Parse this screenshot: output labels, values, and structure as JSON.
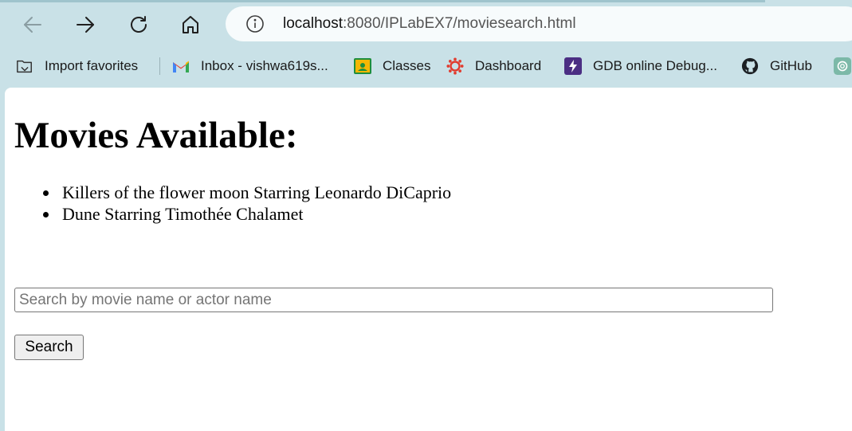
{
  "browser": {
    "url_host": "localhost",
    "url_rest": ":8080/IPLabEX7/moviesearch.html"
  },
  "bookmarks": [
    {
      "label": "Import favorites",
      "icon": "import-favorites-icon"
    },
    {
      "label": "Inbox  - vishwa619s...",
      "icon": "gmail-icon"
    },
    {
      "label": "Classes",
      "icon": "google-classroom-icon"
    },
    {
      "label": "Dashboard",
      "icon": "canvas-dashboard-icon"
    },
    {
      "label": "GDB online Debug...",
      "icon": "gdb-lightning-icon"
    },
    {
      "label": "GitHub",
      "icon": "github-icon"
    }
  ],
  "page": {
    "title": "Movies Available:",
    "movies": [
      "Killers of the flower moon Starring Leonardo DiCaprio",
      "Dune Starring Timothée Chalamet"
    ],
    "search": {
      "placeholder": "Search by movie name or actor name",
      "value": "",
      "button_label": "Search"
    }
  },
  "colors": {
    "chrome_background": "#c9e1e7",
    "address_bar": "#f7fbfc",
    "page_background": "#ffffff"
  }
}
